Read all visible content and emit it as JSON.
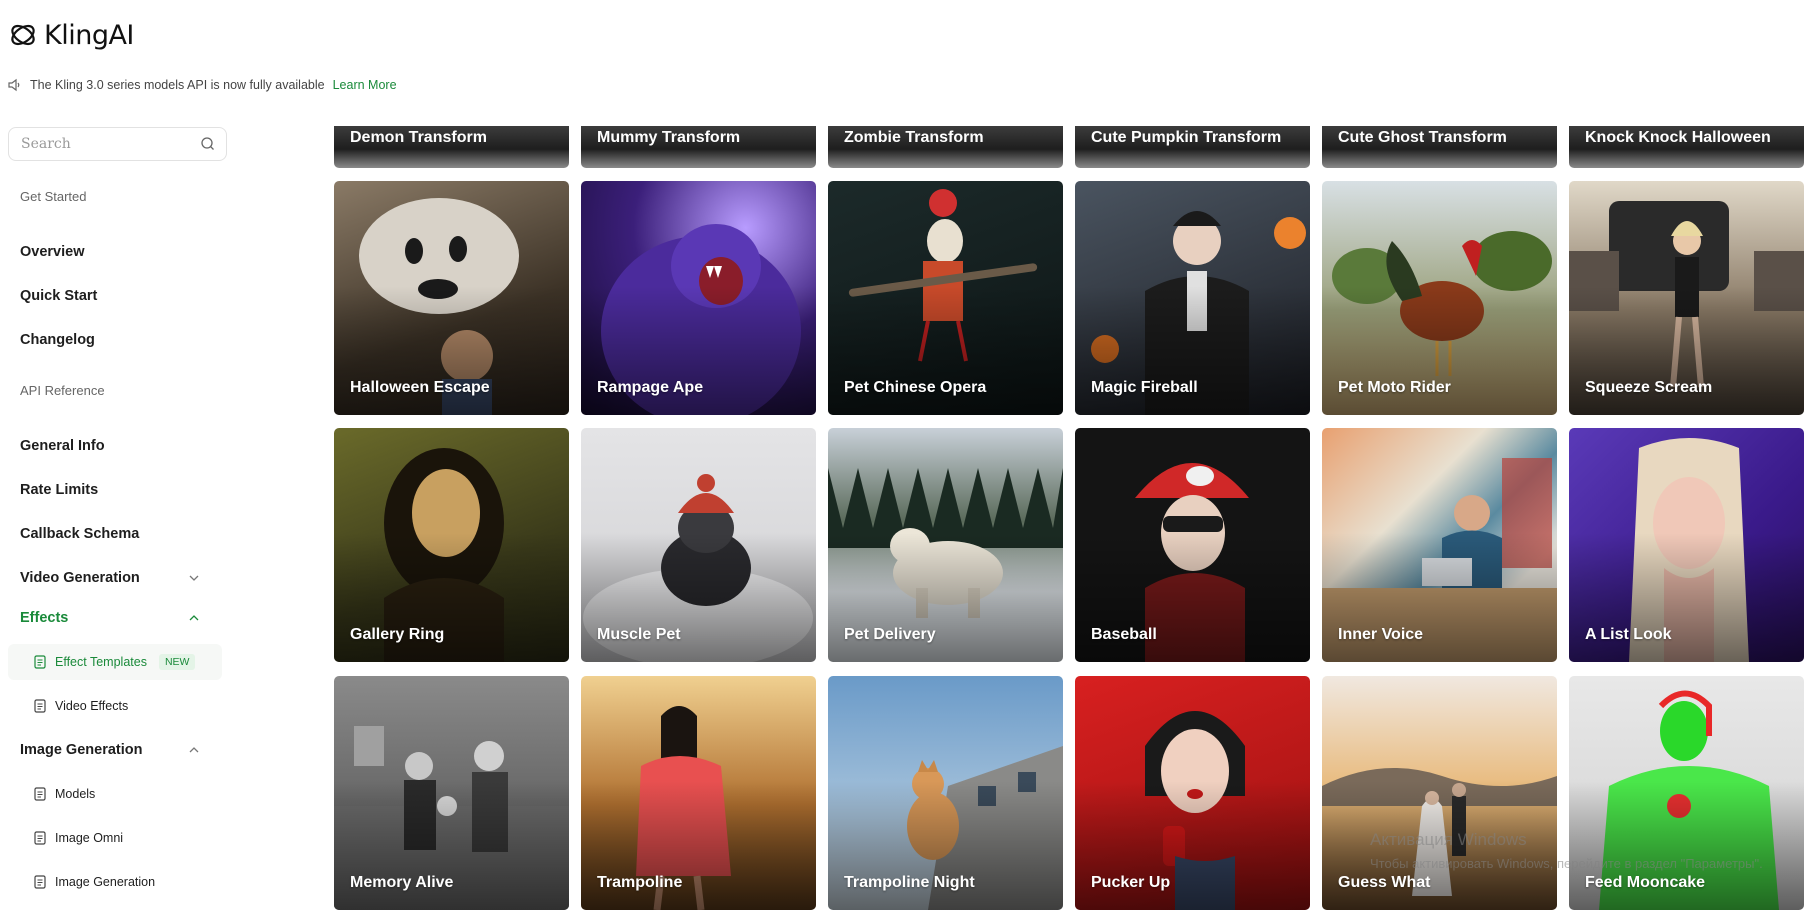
{
  "header": {
    "brand": "KlingAI",
    "announcement": "The Kling 3.0 series models API is now fully available",
    "announcement_link": "Learn More"
  },
  "sidebar": {
    "search_placeholder": "Search",
    "section_get_started": "Get Started",
    "overview": "Overview",
    "quick_start": "Quick Start",
    "changelog": "Changelog",
    "section_api_reference": "API Reference",
    "general_info": "General Info",
    "rate_limits": "Rate Limits",
    "callback_schema": "Callback Schema",
    "video_generation": "Video Generation",
    "effects": "Effects",
    "effect_templates": "Effect Templates",
    "new_badge": "NEW",
    "video_effects": "Video Effects",
    "image_generation": "Image Generation",
    "models": "Models",
    "image_omni": "Image Omni",
    "image_generation_sub": "Image Generation"
  },
  "grid": {
    "top_row": [
      "Demon Transform",
      "Mummy Transform",
      "Zombie Transform",
      "Cute Pumpkin Transform",
      "Cute Ghost Transform",
      "Knock Knock Halloween"
    ],
    "row1": [
      "Halloween Escape",
      "Rampage Ape",
      "Pet Chinese Opera",
      "Magic Fireball",
      "Pet Moto Rider",
      "Squeeze Scream"
    ],
    "row2": [
      "Gallery Ring",
      "Muscle Pet",
      "Pet Delivery",
      "Baseball",
      "Inner Voice",
      "A List Look"
    ],
    "row3": [
      "Memory Alive",
      "Trampoline",
      "Trampoline Night",
      "Pucker Up",
      "Guess What",
      "Feed Mooncake"
    ]
  },
  "watermark": {
    "line1": "Активация Windows",
    "line2": "Чтобы активировать Windows, перейдите в раздел \"Параметры\"."
  },
  "colors": {
    "accent": "#1a8a3a",
    "badge_bg": "#e4f4e7"
  }
}
